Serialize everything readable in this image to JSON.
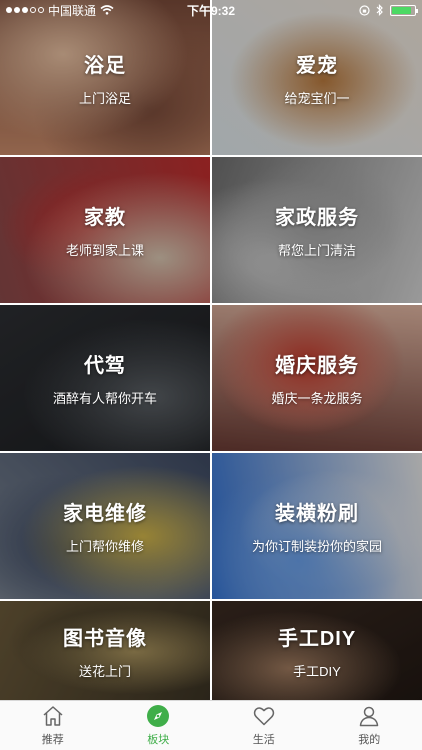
{
  "status_bar": {
    "carrier": "中国联通",
    "time": "下午9:32",
    "battery_level": 0.85,
    "battery_color": "#4cd964"
  },
  "tiles": [
    {
      "title": "浴足",
      "subtitle": "上门浴足",
      "bg_colors": [
        "#c98b6a",
        "#e9c1a2",
        "#7a4b3a"
      ]
    },
    {
      "title": "爱宠",
      "subtitle": "给宠宝们一",
      "bg_colors": [
        "#dfe8ec",
        "#b97a3e",
        "#f1e6da"
      ]
    },
    {
      "title": "家教",
      "subtitle": "老师到家上课",
      "bg_colors": [
        "#8a4a4a",
        "#d9c7b2",
        "#c22e2e"
      ]
    },
    {
      "title": "家政服务",
      "subtitle": "帮您上门清洁",
      "bg_colors": [
        "#6f6f6f",
        "#a3a3a3",
        "#d5d5d5"
      ]
    },
    {
      "title": "代驾",
      "subtitle": "酒醉有人帮你开车",
      "bg_colors": [
        "#2d2f33",
        "#5c6166",
        "#1a1c1f"
      ]
    },
    {
      "title": "婚庆服务",
      "subtitle": "婚庆一条龙服务",
      "bg_colors": [
        "#6a3b34",
        "#c2392b",
        "#e2b7a3"
      ]
    },
    {
      "title": "家电维修",
      "subtitle": "上门帮你维修",
      "bg_colors": [
        "#7d8794",
        "#d2b64a",
        "#3e4a63"
      ]
    },
    {
      "title": "装横粉刷",
      "subtitle": "为你订制装扮你的家园",
      "bg_colors": [
        "#2f6fd1",
        "#6aa0ea",
        "#e8e8e8"
      ]
    },
    {
      "title": "图书音像",
      "subtitle": "送花上门",
      "bg_colors": [
        "#6b5a3a",
        "#a9935d",
        "#3b3324"
      ]
    },
    {
      "title": "手工DIY",
      "subtitle": "手工DIY",
      "bg_colors": [
        "#3b2b22",
        "#a07b5f",
        "#211813"
      ]
    }
  ],
  "tab_bar": {
    "active_color": "#3fae49",
    "tabs": [
      {
        "label": "推荐",
        "icon": "home-icon"
      },
      {
        "label": "板块",
        "icon": "compass-icon"
      },
      {
        "label": "生活",
        "icon": "heart-icon"
      },
      {
        "label": "我的",
        "icon": "person-icon"
      }
    ]
  }
}
